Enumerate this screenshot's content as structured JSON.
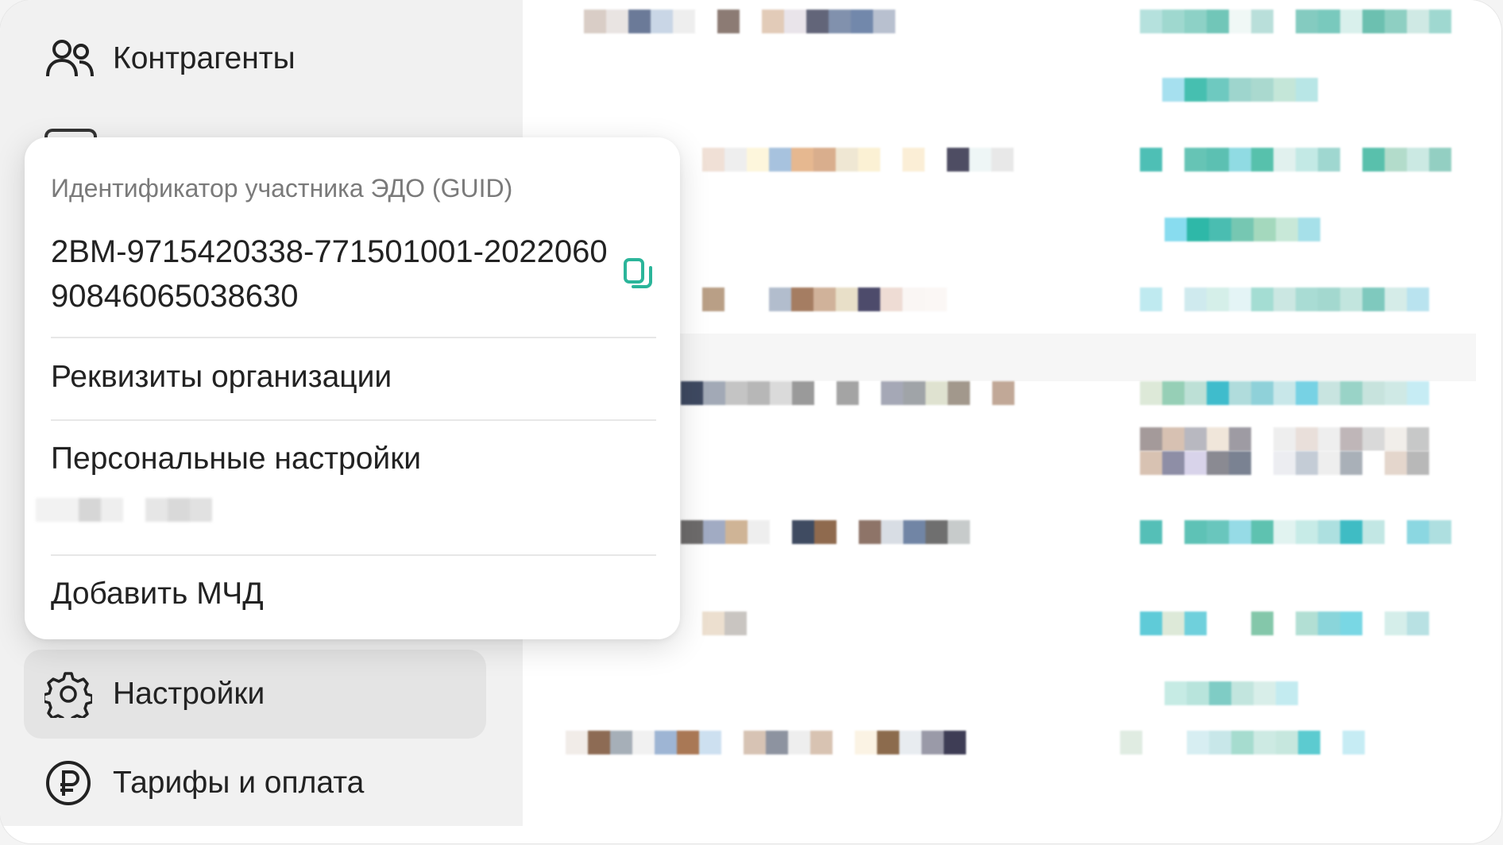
{
  "sidebar": {
    "items": [
      {
        "label": "Контрагенты",
        "icon": "users-icon"
      },
      {
        "label": "Настройки",
        "icon": "gear-icon",
        "active": true
      },
      {
        "label": "Тарифы и оплата",
        "icon": "ruble-icon"
      }
    ]
  },
  "popup": {
    "caption": "Идентификатор участника ЭДО (GUID)",
    "guid": "2BM-9715420338-771501001-2022060 90846065038630",
    "copy_icon": "copy-icon",
    "menu": [
      {
        "label": "Реквизиты организации"
      },
      {
        "label": "Персональные настройки"
      },
      {
        "label": "Добавить МЧД"
      }
    ]
  },
  "colors": {
    "accent": "#2bb59a",
    "sidebar_bg": "#f1f1f1",
    "active_bg": "#e4e4e4"
  }
}
